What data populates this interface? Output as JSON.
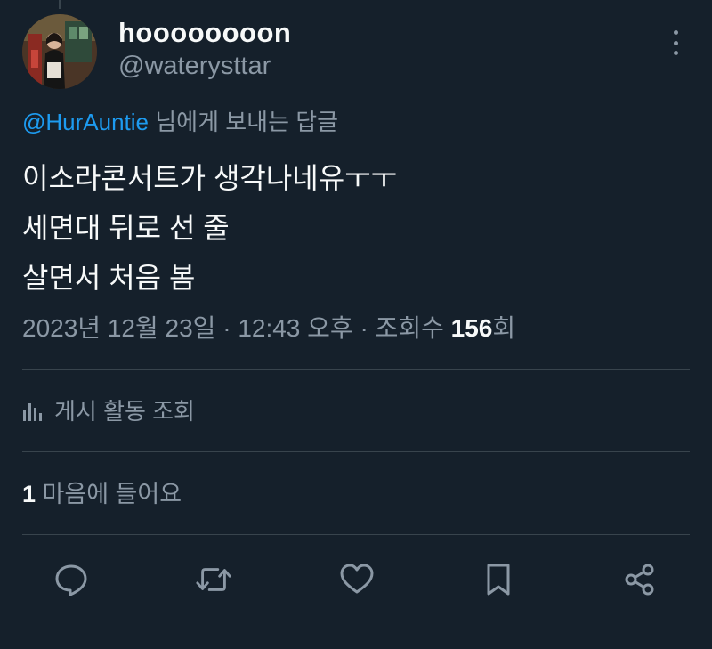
{
  "author": {
    "display_name": "hoooooooon",
    "handle": "@waterysttar"
  },
  "reply_to": {
    "mention": "@HurAuntie",
    "suffix": " 님에게 보내는 답글"
  },
  "tweet": {
    "lines": [
      "이소라콘서트가 생각나네유ㅜㅜ",
      "세면대 뒤로 선 줄",
      "살면서 처음 봄"
    ]
  },
  "meta": {
    "date": "2023년 12월 23일",
    "sep1": " · ",
    "time": "12:43 오후",
    "sep2": " · ",
    "views_label": "조회수 ",
    "views_count": "156",
    "views_unit": "회"
  },
  "activity": {
    "label": "게시 활동 조회"
  },
  "likes": {
    "count": "1",
    "label": " 마음에 들어요"
  },
  "icons": {
    "more": "more-vertical-icon",
    "analytics": "bar-chart-icon",
    "reply": "reply-bubble-icon",
    "retweet": "retweet-icon",
    "like": "heart-icon",
    "bookmark": "bookmark-icon",
    "share": "share-icon"
  },
  "colors": {
    "background": "#15202b",
    "text_primary": "#f7f9f9",
    "text_secondary": "#8b98a5",
    "link": "#1d9bf0",
    "divider": "#38444d"
  }
}
